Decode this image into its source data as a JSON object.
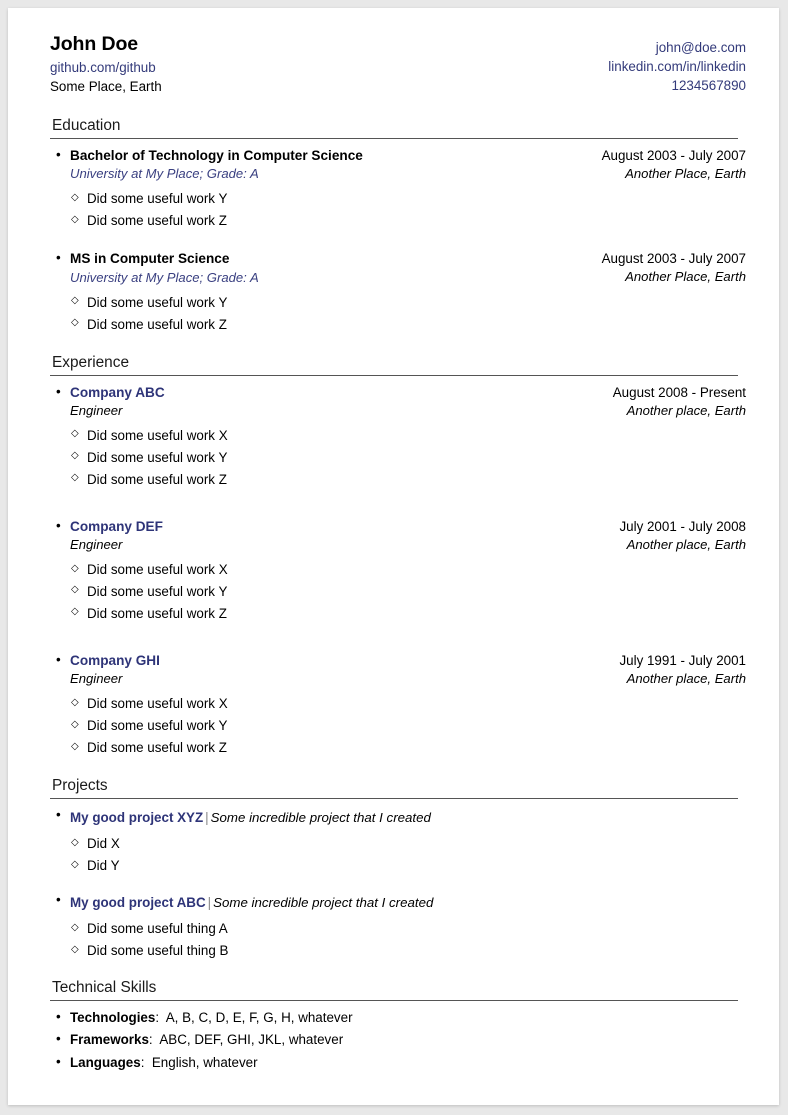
{
  "header": {
    "name": "John Doe",
    "github": "github.com/github",
    "location": "Some Place, Earth",
    "email": "john@doe.com",
    "linkedin": "linkedin.com/in/linkedin",
    "phone": "1234567890"
  },
  "colors": {
    "accent": "#2e3478",
    "link": "#333a7a",
    "rule": "#555555",
    "page_background": "#e8e8e8",
    "card": "#ffffff"
  },
  "sections": {
    "education": {
      "title": "Education",
      "entries": [
        {
          "title": "Bachelor of Technology in Computer Science",
          "subtitle": "University at My Place; Grade: A",
          "date": "August 2003 - July 2007",
          "location": "Another Place, Earth",
          "bullets": [
            "Did some useful work Y",
            "Did some useful work Z"
          ]
        },
        {
          "title": "MS in Computer Science",
          "subtitle": "University at My Place; Grade: A",
          "date": "August 2003 - July 2007",
          "location": "Another Place, Earth",
          "bullets": [
            "Did some useful work Y",
            "Did some useful work Z"
          ]
        }
      ]
    },
    "experience": {
      "title": "Experience",
      "entries": [
        {
          "title": "Company ABC",
          "subtitle": "Engineer",
          "date": "August 2008 - Present",
          "location": "Another place, Earth",
          "bullets": [
            "Did some useful work X",
            "Did some useful work Y",
            "Did some useful work Z"
          ]
        },
        {
          "title": "Company DEF",
          "subtitle": "Engineer",
          "date": "July 2001 - July 2008",
          "location": "Another place, Earth",
          "bullets": [
            "Did some useful work X",
            "Did some useful work Y",
            "Did some useful work Z"
          ]
        },
        {
          "title": "Company GHI",
          "subtitle": "Engineer",
          "date": "July 1991 - July 2001",
          "location": "Another place, Earth",
          "bullets": [
            "Did some useful work X",
            "Did some useful work Y",
            "Did some useful work Z"
          ]
        }
      ]
    },
    "projects": {
      "title": "Projects",
      "separator": "|",
      "entries": [
        {
          "name": "My good project XYZ",
          "description": "Some incredible project that I created",
          "bullets": [
            "Did X",
            "Did Y"
          ]
        },
        {
          "name": "My good project ABC",
          "description": "Some incredible project that I created",
          "bullets": [
            "Did some useful thing A",
            "Did some useful thing B"
          ]
        }
      ]
    },
    "skills": {
      "title": "Technical Skills",
      "colon": ":",
      "entries": [
        {
          "category": "Technologies",
          "values": "A, B, C, D, E, F, G, H, whatever"
        },
        {
          "category": "Frameworks",
          "values": "ABC, DEF, GHI, JKL, whatever"
        },
        {
          "category": "Languages",
          "values": "English, whatever"
        }
      ]
    }
  }
}
